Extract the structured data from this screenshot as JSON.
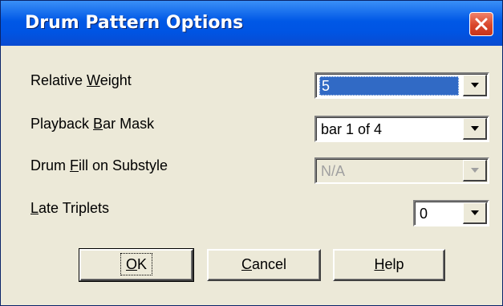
{
  "dialog": {
    "title": "Drum Pattern Options"
  },
  "fields": [
    {
      "label_pre": "Relative ",
      "label_accel": "W",
      "label_post": "eight",
      "value": "5"
    },
    {
      "label_pre": "Playback ",
      "label_accel": "B",
      "label_post": "ar Mask",
      "value": "bar 1 of 4"
    },
    {
      "label_pre": "Drum ",
      "label_accel": "F",
      "label_post": "ill on Substyle",
      "value": "N/A"
    },
    {
      "label_pre": "",
      "label_accel": "L",
      "label_post": "ate Triplets",
      "value": "0"
    }
  ],
  "buttons": [
    {
      "accel": "O",
      "rest": "K"
    },
    {
      "accel": "C",
      "rest": "ancel"
    },
    {
      "accel": "H",
      "rest": "elp"
    }
  ],
  "icons": {
    "close": "close-x-icon",
    "dropdown": "chevron-down-icon"
  },
  "colors": {
    "titlebar": "#0054e3",
    "close_button": "#d9472b",
    "dialog_bg": "#ece9d8",
    "selection": "#316ac5",
    "disabled_text": "#a0a0a0"
  }
}
